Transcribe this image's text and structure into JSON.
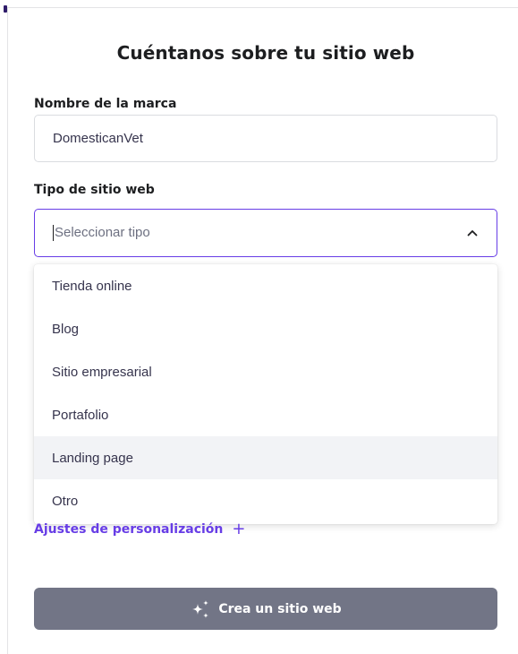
{
  "form": {
    "title": "Cuéntanos sobre tu sitio web",
    "brand_label": "Nombre de la marca",
    "brand_value": "DomesticanVet",
    "type_label": "Tipo de sitio web",
    "type_placeholder": "Seleccionar tipo",
    "type_options": [
      "Tienda online",
      "Blog",
      "Sitio empresarial",
      "Portafolio",
      "Landing page",
      "Otro"
    ],
    "highlighted_option": "Landing page",
    "customization_link": "Ajustes de personalización",
    "customization_plus": "+",
    "submit_label": "Crea un sitio web"
  },
  "icons": {
    "select_toggle": "chevron-up-icon",
    "submit": "sparkle-icon"
  },
  "colors": {
    "accent": "#673de6",
    "button_disabled": "#727586",
    "text": "#1d1e20",
    "option_hover": "#f2f3f6"
  }
}
